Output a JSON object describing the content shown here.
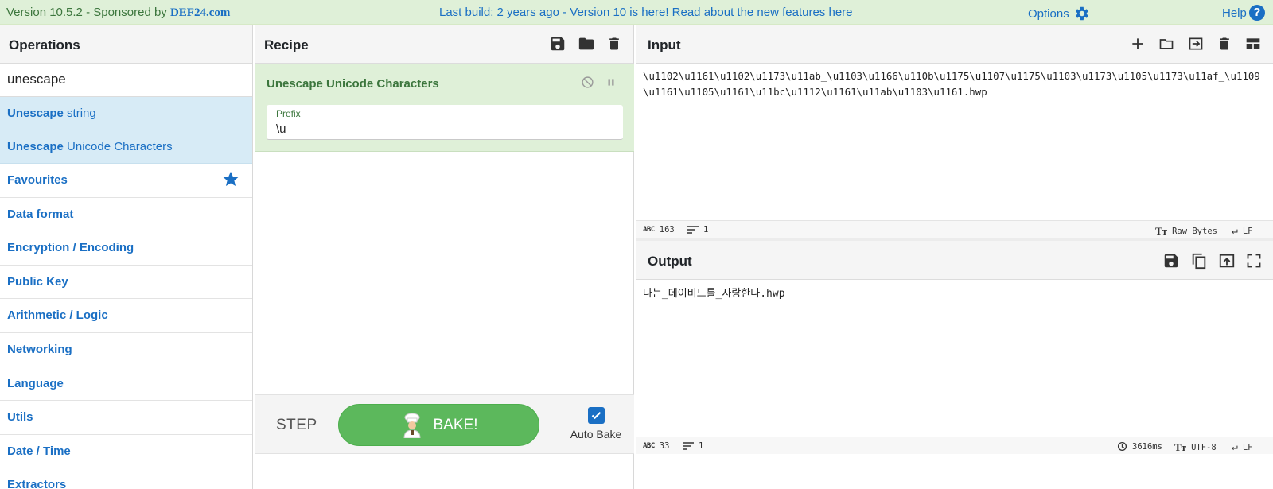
{
  "banner": {
    "version_text": "Version 10.5.2 - Sponsored by ",
    "sponsor": "DEF24.com",
    "center_text": "Last build: 2 years ago - Version 10 is here! Read about the new features here",
    "options_label": "Options",
    "help_label": "Help",
    "colors": {
      "background": "#dff0d8",
      "link": "#1a6fc4",
      "text": "#3c763d"
    }
  },
  "operations": {
    "title": "Operations",
    "search_value": "unescape",
    "results": [
      {
        "match": "Unescape",
        "rest": " string"
      },
      {
        "match": "Unescape",
        "rest": " Unicode Characters"
      }
    ],
    "categories": [
      "Favourites",
      "Data format",
      "Encryption / Encoding",
      "Public Key",
      "Arithmetic / Logic",
      "Networking",
      "Language",
      "Utils",
      "Date / Time",
      "Extractors"
    ]
  },
  "recipe": {
    "title": "Recipe",
    "operation": {
      "name": "Unescape Unicode Characters",
      "arg_label": "Prefix",
      "arg_value": "\\u"
    },
    "step_label": "STEP",
    "bake_label": "BAKE!",
    "autobake_label": "Auto Bake",
    "autobake_checked": true,
    "colors": {
      "op_bg": "#dff0d8",
      "bake": "#5cb85c"
    }
  },
  "input": {
    "title": "Input",
    "text": "\\u1102\\u1161\\u1102\\u1173\\u11ab_\\u1103\\u1166\\u110b\\u1175\\u1107\\u1175\\u1103\\u1173\\u1105\\u1173\\u11af_\\u1109\\u1161\\u1105\\u1161\\u11bc\\u1112\\u1161\\u11ab\\u1103\\u1161.hwp",
    "status": {
      "chars": "163",
      "lines": "1",
      "encoding": "Raw Bytes",
      "eol": "LF"
    }
  },
  "output": {
    "title": "Output",
    "text": "나는_데이비드를_사랑한다.hwp",
    "status": {
      "chars": "33",
      "lines": "1",
      "time": "3616ms",
      "encoding": "UTF-8",
      "eol": "LF"
    }
  }
}
